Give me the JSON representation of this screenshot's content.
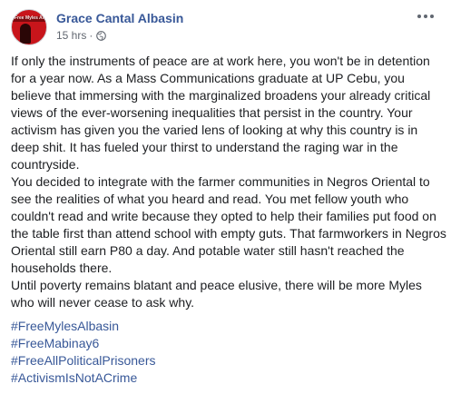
{
  "post": {
    "author": "Grace Cantal Albasin",
    "avatar_text": "Free Myles Albasin",
    "timestamp": "15 hrs",
    "separator": "·",
    "privacy_icon": "globe-icon",
    "more_icon": "more-options-icon",
    "paragraphs": [
      "If only the instruments of peace are at work here, you won't be in detention for a year now. As a Mass Communications graduate at UP Cebu, you believe that immersing with the marginalized broadens your already critical views of the ever-worsening inequalities that persist in the country. Your activism has given you the varied lens of looking at why this country is in deep shit. It has fueled your thirst to understand the raging war in the countryside.",
      "You decided to integrate with the farmer communities in Negros Oriental to see the realities of what you heard and read. You met fellow youth who couldn't read and write because they opted to help their families put food on the table first than attend school with empty guts. That farmworkers in Negros Oriental still earn P80 a day. And potable water still hasn't reached the households there.",
      "Until poverty remains blatant and peace elusive, there will be more Myles who will never cease to ask why."
    ],
    "hashtags": [
      "#FreeMylesAlbasin",
      "#FreeMabinay6",
      "#FreeAllPoliticalPrisoners",
      "#ActivismIsNotACrime"
    ]
  },
  "colors": {
    "link": "#385898",
    "text": "#1c1e21",
    "meta": "#616770",
    "avatar_bg": "#c8151b"
  }
}
